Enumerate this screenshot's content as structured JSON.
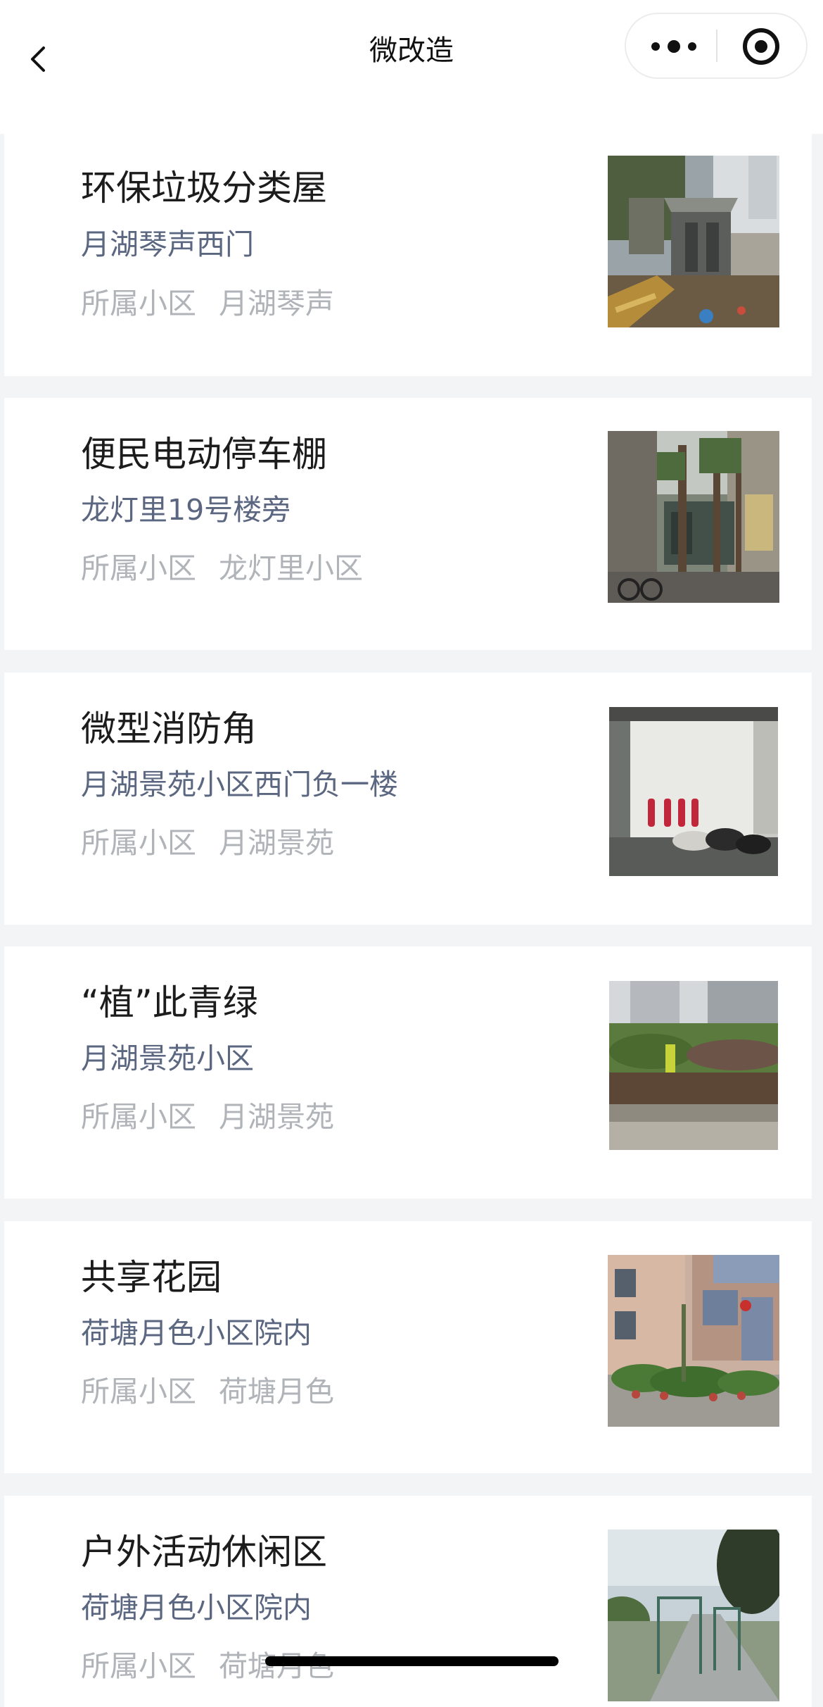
{
  "nav": {
    "title": "微改造"
  },
  "items": [
    {
      "title": "环保垃圾分类屋",
      "address": "月湖琴声西门",
      "community_label": "所属小区",
      "community": "月湖琴声",
      "image": "garbage-sorting-house-photo"
    },
    {
      "title": "便民电动停车棚",
      "address": "龙灯里19号楼旁",
      "community_label": "所属小区",
      "community": "龙灯里小区",
      "image": "electric-bike-shed-photo"
    },
    {
      "title": "微型消防角",
      "address": "月湖景苑小区西门负一楼",
      "community_label": "所属小区",
      "community": "月湖景苑",
      "image": "fire-station-corner-photo"
    },
    {
      "title": "“植”此青绿",
      "address": "月湖景苑小区",
      "community_label": "所属小区",
      "community": "月湖景苑",
      "image": "green-planting-photo"
    },
    {
      "title": "共享花园",
      "address": "荷塘月色小区院内",
      "community_label": "所属小区",
      "community": "荷塘月色",
      "image": "shared-garden-photo"
    },
    {
      "title": "户外活动休闲区",
      "address": "荷塘月色小区院内",
      "community_label": "所属小区",
      "community": "荷塘月色",
      "image": "outdoor-leisure-area-photo"
    }
  ]
}
